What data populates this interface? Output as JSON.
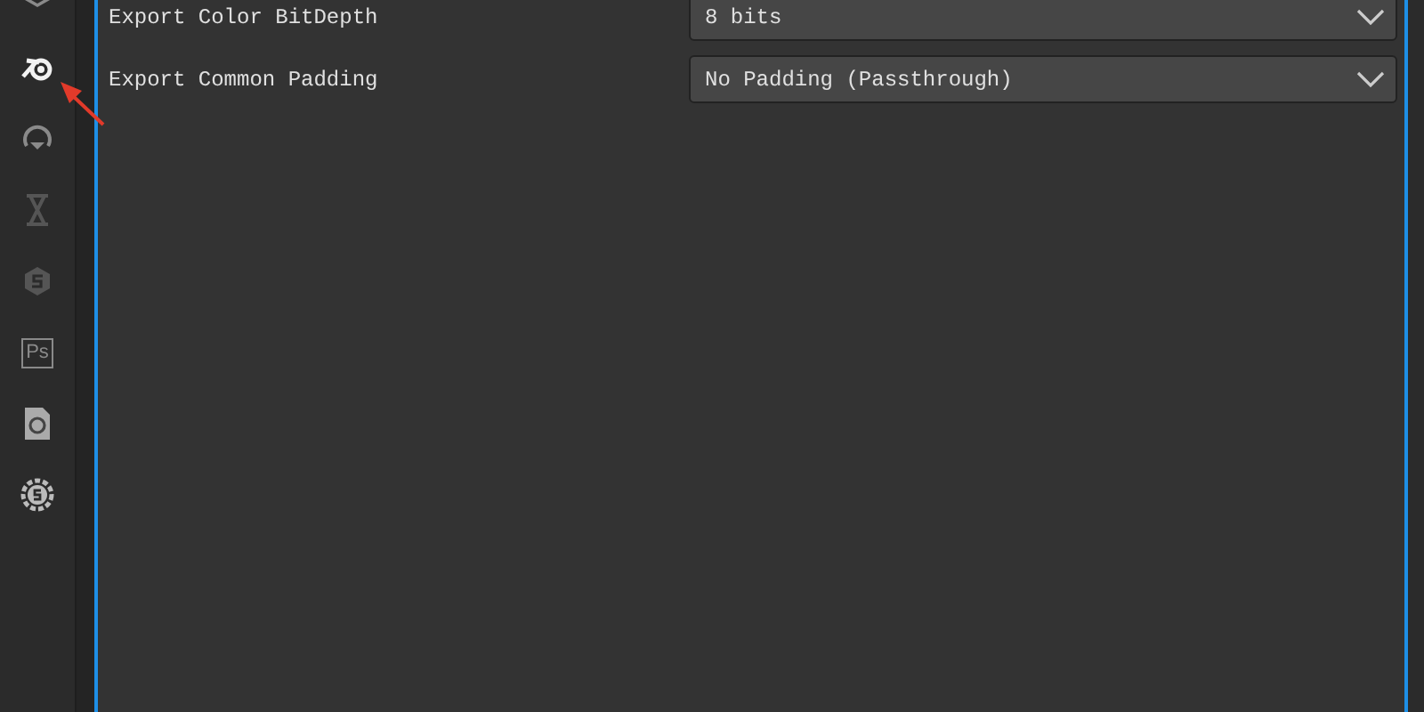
{
  "sidebar": {
    "items": [
      {
        "kind": "cube",
        "selected": false
      },
      {
        "kind": "blender",
        "selected": true
      },
      {
        "kind": "headset",
        "selected": false
      },
      {
        "kind": "hourglass",
        "selected": false
      },
      {
        "kind": "hex-s",
        "selected": false
      },
      {
        "kind": "ps",
        "label": "Ps",
        "selected": false
      },
      {
        "kind": "doc",
        "selected": false
      },
      {
        "kind": "gear-s",
        "selected": false
      }
    ]
  },
  "annotation": {
    "kind": "arrow"
  },
  "settings": [
    {
      "label": "Export Color BitDepth",
      "value": "8 bits"
    },
    {
      "label": "Export Common Padding",
      "value": "No Padding (Passthrough)"
    }
  ]
}
